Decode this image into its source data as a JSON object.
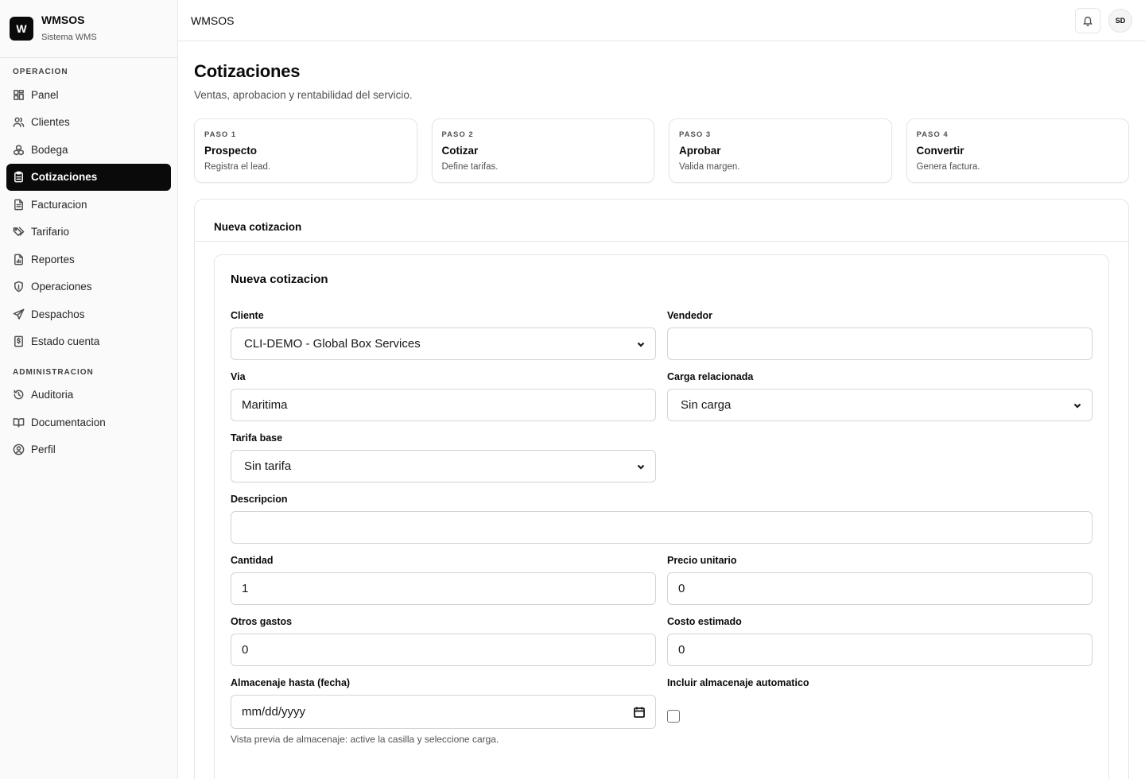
{
  "brand": {
    "logo_letter": "W",
    "name": "WMSOS",
    "subtitle": "Sistema WMS"
  },
  "sidebar": {
    "sections": [
      {
        "label": "OPERACION",
        "items": [
          {
            "label": "Panel",
            "icon": "grid-icon",
            "active": false
          },
          {
            "label": "Clientes",
            "icon": "users-icon",
            "active": false
          },
          {
            "label": "Bodega",
            "icon": "boxes-icon",
            "active": false
          },
          {
            "label": "Cotizaciones",
            "icon": "clipboard-icon",
            "active": true
          },
          {
            "label": "Facturacion",
            "icon": "file-text-icon",
            "active": false
          },
          {
            "label": "Tarifario",
            "icon": "tags-icon",
            "active": false
          },
          {
            "label": "Reportes",
            "icon": "file-chart-icon",
            "active": false
          },
          {
            "label": "Operaciones",
            "icon": "shield-icon",
            "active": false
          },
          {
            "label": "Despachos",
            "icon": "send-icon",
            "active": false
          },
          {
            "label": "Estado cuenta",
            "icon": "receipt-dollar-icon",
            "active": false
          }
        ]
      },
      {
        "label": "ADMINISTRACION",
        "items": [
          {
            "label": "Auditoria",
            "icon": "history-icon",
            "active": false
          },
          {
            "label": "Documentacion",
            "icon": "book-icon",
            "active": false
          },
          {
            "label": "Perfil",
            "icon": "user-circle-icon",
            "active": false
          }
        ]
      }
    ]
  },
  "topbar": {
    "title": "WMSOS",
    "bell_icon": "bell-icon",
    "avatar_initials": "SD"
  },
  "page": {
    "title": "Cotizaciones",
    "subtitle": "Ventas, aprobacion y rentabilidad del servicio."
  },
  "steps": [
    {
      "tag": "PASO 1",
      "name": "Prospecto",
      "desc": "Registra el lead."
    },
    {
      "tag": "PASO 2",
      "name": "Cotizar",
      "desc": "Define tarifas."
    },
    {
      "tag": "PASO 3",
      "name": "Aprobar",
      "desc": "Valida margen."
    },
    {
      "tag": "PASO 4",
      "name": "Convertir",
      "desc": "Genera factura."
    }
  ],
  "panel": {
    "tab_label": "Nueva cotizacion"
  },
  "form": {
    "title": "Nueva cotizacion",
    "cliente": {
      "label": "Cliente",
      "value": "CLI-DEMO - Global Box Services"
    },
    "vendedor": {
      "label": "Vendedor",
      "value": ""
    },
    "via": {
      "label": "Via",
      "value": "Maritima"
    },
    "carga": {
      "label": "Carga relacionada",
      "value": "Sin carga"
    },
    "tarifa": {
      "label": "Tarifa base",
      "value": "Sin tarifa"
    },
    "descripcion": {
      "label": "Descripcion",
      "value": ""
    },
    "cantidad": {
      "label": "Cantidad",
      "value": "1"
    },
    "precio": {
      "label": "Precio unitario",
      "value": "0"
    },
    "otros": {
      "label": "Otros gastos",
      "value": "0"
    },
    "costo": {
      "label": "Costo estimado",
      "value": "0"
    },
    "almacenaje_fecha": {
      "label": "Almacenaje hasta (fecha)",
      "placeholder": "mm/dd/yyyy"
    },
    "almacenaje_auto": {
      "label": "Incluir almacenaje automatico",
      "checked": false
    },
    "hint": "Vista previa de almacenaje: active la casilla y seleccione carga."
  }
}
